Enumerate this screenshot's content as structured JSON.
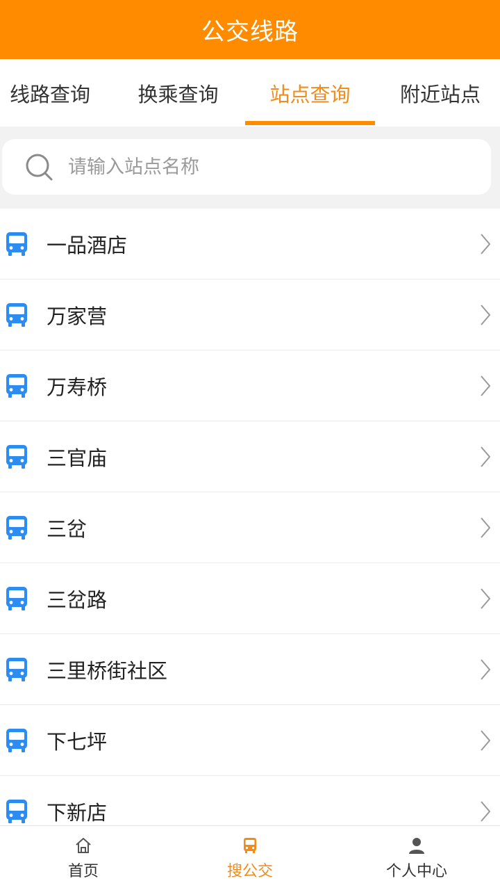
{
  "header": {
    "title": "公交线路"
  },
  "tabs": [
    {
      "label": "线路查询",
      "active": false
    },
    {
      "label": "换乘查询",
      "active": false
    },
    {
      "label": "站点查询",
      "active": true
    },
    {
      "label": "附近站点",
      "active": false
    }
  ],
  "search": {
    "placeholder": "请输入站点名称",
    "value": ""
  },
  "stations": [
    {
      "name": "一品酒店"
    },
    {
      "name": "万家营"
    },
    {
      "name": "万寿桥"
    },
    {
      "name": "三官庙"
    },
    {
      "name": "三岔"
    },
    {
      "name": "三岔路"
    },
    {
      "name": "三里桥街社区"
    },
    {
      "name": "下七坪"
    },
    {
      "name": "下新店"
    }
  ],
  "bottom_nav": [
    {
      "label": "首页",
      "icon": "home-icon",
      "active": false
    },
    {
      "label": "搜公交",
      "icon": "bus-icon",
      "active": true
    },
    {
      "label": "个人中心",
      "icon": "person-icon",
      "active": false
    }
  ],
  "colors": {
    "accent": "#ff8c00",
    "active_text": "#f08c1c",
    "bus_icon": "#2d8cf0"
  }
}
